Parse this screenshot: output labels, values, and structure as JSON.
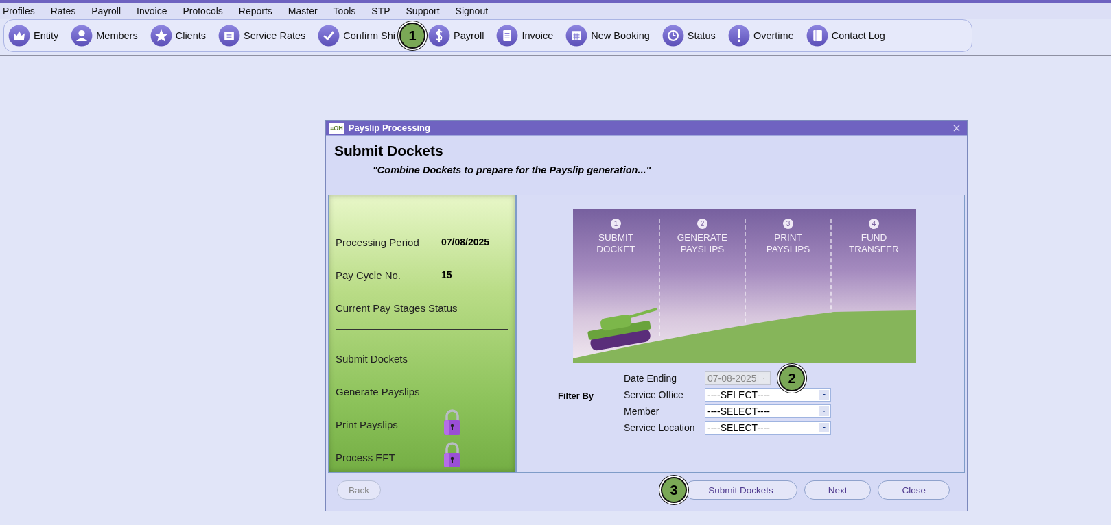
{
  "menu": [
    "Profiles",
    "Rates",
    "Payroll",
    "Invoice",
    "Protocols",
    "Reports",
    "Master",
    "Tools",
    "STP",
    "Support",
    "Signout"
  ],
  "toolbar": [
    {
      "label": "Entity"
    },
    {
      "label": "Members"
    },
    {
      "label": "Clients"
    },
    {
      "label": "Service Rates"
    },
    {
      "label": "Confirm Shi",
      "callout": "1"
    },
    {
      "label": "Payroll"
    },
    {
      "label": "Invoice"
    },
    {
      "label": "New Booking"
    },
    {
      "label": "Status"
    },
    {
      "label": "Overtime"
    },
    {
      "label": "Contact Log"
    }
  ],
  "dialog": {
    "title": "Payslip Processing",
    "logo": "≡OH",
    "heading": "Submit Dockets",
    "subtitle": "\"Combine Dockets to prepare for the Payslip generation...\"",
    "summary": [
      {
        "label": "Processing Period",
        "value": "07/08/2025"
      },
      {
        "label": "Pay Cycle No.",
        "value": "15"
      }
    ],
    "stages_heading": "Current Pay Stages Status",
    "stages": [
      {
        "label": "Submit Dockets",
        "locked": false
      },
      {
        "label": "Generate Payslips",
        "locked": false
      },
      {
        "label": "Print Payslips",
        "locked": true
      },
      {
        "label": "Process EFT",
        "locked": true
      }
    ],
    "steps": [
      {
        "number": "1",
        "line1": "SUBMIT",
        "line2": "DOCKET"
      },
      {
        "number": "2",
        "line1": "GENERATE",
        "line2": "PAYSLIPS"
      },
      {
        "number": "3",
        "line1": "PRINT",
        "line2": "PAYSLIPS"
      },
      {
        "number": "4",
        "line1": "FUND",
        "line2": "TRANSFER"
      }
    ],
    "filter_label": "Filter By",
    "filters": [
      {
        "label": "Date Ending",
        "value": "07-08-2025",
        "disabled": true,
        "callout": "2"
      },
      {
        "label": "Service Office",
        "value": "----SELECT----",
        "disabled": false
      },
      {
        "label": "Member",
        "value": "----SELECT----",
        "disabled": false
      },
      {
        "label": "Service Location",
        "value": "----SELECT----",
        "disabled": false
      }
    ],
    "buttons": [
      {
        "label": "Back",
        "disabled": true
      },
      {
        "label": "Submit Dockets",
        "disabled": false,
        "callout": "3"
      },
      {
        "label": "Next",
        "disabled": false
      },
      {
        "label": "Close",
        "disabled": false
      }
    ]
  }
}
